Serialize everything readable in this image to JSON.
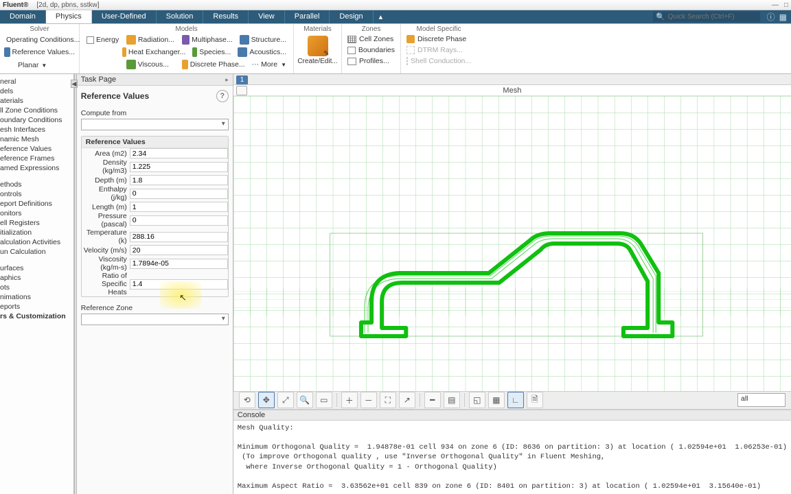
{
  "title": {
    "app": "Fluent®",
    "doc": "[2d, dp, pbns, sstkw]"
  },
  "window_controls": {
    "min": "—",
    "max": "□",
    "close": ""
  },
  "ribbon": {
    "tabs": {
      "domain": "Domain",
      "physics": "Physics",
      "user_defined": "User-Defined",
      "solution": "Solution",
      "results": "Results",
      "view": "View",
      "parallel": "Parallel",
      "design": "Design"
    },
    "solver_group": {
      "label": "Solver",
      "operating": "Operating Conditions...",
      "reference": "Reference Values...",
      "planar": "Planar"
    },
    "models_group": {
      "label": "Models",
      "energy": "Energy",
      "radiation": "Radiation...",
      "multiphase": "Multiphase...",
      "structure": "Structure...",
      "heat_exchanger": "Heat Exchanger...",
      "species": "Species...",
      "acoustics": "Acoustics...",
      "viscous": "Viscous...",
      "discrete_phase": "Discrete Phase...",
      "more": "More"
    },
    "materials_group": {
      "label": "Materials",
      "create_edit": "Create/Edit..."
    },
    "zones_group": {
      "label": "Zones",
      "cell_zones": "Cell Zones",
      "boundaries": "Boundaries",
      "profiles": "Profiles..."
    },
    "model_specific_group": {
      "label": "Model Specific",
      "discrete_phase": "Discrete Phase",
      "dtrm_rays": "DTRM Rays...",
      "shell_conduction": "Shell Conduction..."
    }
  },
  "search": {
    "placeholder": "Quick Search (Ctrl+F)"
  },
  "outline": {
    "items_top": [
      "neral",
      "dels",
      "aterials",
      "ll Zone Conditions",
      "oundary Conditions",
      "esh Interfaces",
      "namic Mesh",
      "eference Values",
      "eference Frames",
      "amed Expressions"
    ],
    "items_mid": [
      "ethods",
      "ontrols",
      "eport Definitions",
      "onitors",
      "ell Registers",
      "itialization",
      "alculation Activities",
      "un Calculation"
    ],
    "items_bot": [
      "urfaces",
      "aphics",
      "ots",
      "nimations",
      "eports",
      "rs & Customization"
    ]
  },
  "taskpage": {
    "header": "Task Page",
    "title": "Reference Values",
    "compute_from": "Compute from",
    "section": "Reference Values",
    "rows": [
      {
        "l": "Area (m2)",
        "v": "2.34"
      },
      {
        "l": "Density (kg/m3)",
        "v": "1.225"
      },
      {
        "l": "Depth (m)",
        "v": "1.8"
      },
      {
        "l": "Enthalpy (j/kg)",
        "v": "0"
      },
      {
        "l": "Length (m)",
        "v": "1"
      },
      {
        "l": "Pressure (pascal)",
        "v": "0"
      },
      {
        "l": "Temperature (k)",
        "v": "288.16"
      },
      {
        "l": "Velocity (m/s)",
        "v": "20"
      },
      {
        "l": "Viscosity (kg/m-s)",
        "v": "1.7894e-05"
      },
      {
        "l": "Ratio of Specific Heats",
        "v": "1.4"
      }
    ],
    "reference_zone": "Reference Zone"
  },
  "graphics": {
    "tab": "1",
    "title": "Mesh",
    "display_select": "all"
  },
  "console": {
    "header": "Console",
    "lines": [
      "Mesh Quality:",
      "",
      "Minimum Orthogonal Quality =  1.94878e-01 cell 934 on zone 6 (ID: 8636 on partition: 3) at location ( 1.02594e+01  1.06253e-01)",
      " (To improve Orthogonal quality , use \"Inverse Orthogonal Quality\" in Fluent Meshing,",
      "  where Inverse Orthogonal Quality = 1 - Orthogonal Quality)",
      "",
      "Maximum Aspect Ratio =  3.63562e+01 cell 839 on zone 6 (ID: 8401 on partition: 3) at location ( 1.02594e+01  3.15640e-01)"
    ]
  }
}
